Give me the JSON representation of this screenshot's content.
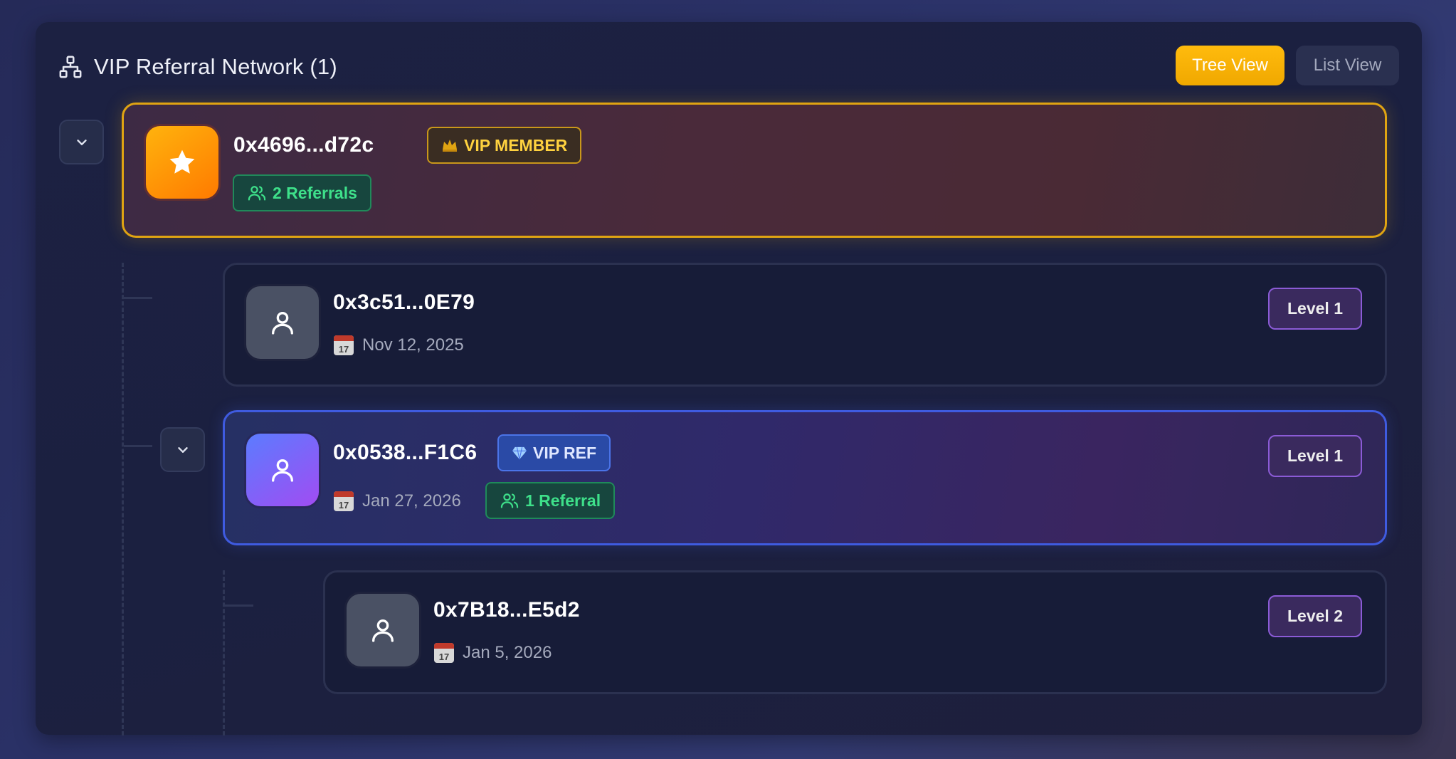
{
  "header": {
    "title": "VIP Referral Network (1)",
    "tree_view_label": "Tree View",
    "list_view_label": "List View"
  },
  "colors": {
    "accent": "#ffbb0d",
    "vip_border": "#e0a412",
    "referral_green": "#3ee08a",
    "vip_ref_blue": "#3f5be0",
    "level_purple": "#8b5bd6"
  },
  "root": {
    "address": "0x4696...d72c",
    "badge_label": "VIP MEMBER",
    "referrals_label": "2 Referrals",
    "icon": "star-icon"
  },
  "nodes": [
    {
      "address": "0x3c51...0E79",
      "date": "Nov 12, 2025",
      "level": "Level 1",
      "icon": "user-icon"
    },
    {
      "address": "0x0538...F1C6",
      "badge_label": "VIP REF",
      "date": "Jan 27, 2026",
      "referrals_label": "1 Referral",
      "level": "Level 1",
      "icon": "user-icon"
    },
    {
      "address": "0x7B18...E5d2",
      "date": "Jan 5, 2026",
      "level": "Level 2",
      "icon": "user-icon"
    }
  ],
  "calendar_day": "17"
}
